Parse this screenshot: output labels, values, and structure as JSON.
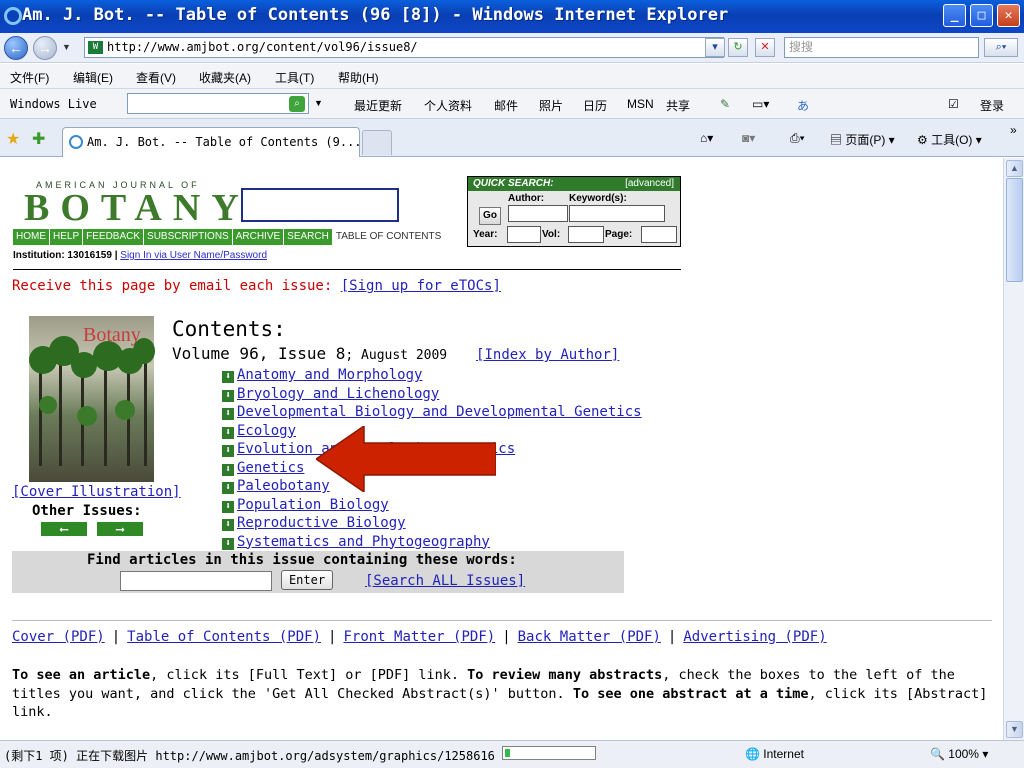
{
  "window": {
    "title": "Am. J. Bot. -- Table of Contents (96 [8]) - Windows Internet Explorer",
    "buttons": {
      "minimize": "_",
      "maximize": "□",
      "close": "✕"
    }
  },
  "address_bar": {
    "url": "http://www.amjbot.org/content/vol96/issue8/",
    "search_placeholder": "搜搜"
  },
  "menu": [
    "文件(F)",
    "编辑(E)",
    "查看(V)",
    "收藏夹(A)",
    "工具(T)",
    "帮助(H)"
  ],
  "windows_live": {
    "label": "Windows Live",
    "links": [
      "最近更新",
      "个人资料",
      "邮件",
      "照片",
      "日历",
      "MSN",
      "共享"
    ],
    "login": "登录"
  },
  "tabs": {
    "active": "Am. J. Bot. -- Table of Contents (9...",
    "tools": [
      "页面(P)",
      "工具(O)"
    ]
  },
  "header": {
    "logo_small": "AMERICAN JOURNAL OF",
    "logo_big": "BOTANY",
    "nav": [
      "HOME",
      "HELP",
      "FEEDBACK",
      "SUBSCRIPTIONS",
      "ARCHIVE",
      "SEARCH",
      "TABLE OF CONTENTS"
    ],
    "institution": "Institution: 13016159",
    "signin": "Sign In via User Name/Password"
  },
  "quick_search": {
    "title": "QUICK SEARCH:",
    "advanced": "[advanced]",
    "author_label": "Author:",
    "keywords_label": "Keyword(s):",
    "go": "Go",
    "year_label": "Year:",
    "vol_label": "Vol:",
    "page_label": "Page:"
  },
  "email": {
    "text": "Receive this page by email each issue:",
    "link": "[Sign up for eTOCs]"
  },
  "cover": {
    "title": "Botany",
    "illustration_link": "[Cover Illustration]",
    "other_issues": "Other Issues:"
  },
  "contents": {
    "heading": "Contents:",
    "volume": "Volume 96, Issue 8",
    "date": "; August 2009",
    "index_link": "[Index by Author]",
    "sections": [
      "Anatomy and Morphology",
      "Bryology and Lichenology",
      "Developmental Biology and Developmental Genetics",
      "Ecology",
      "Evolution and Population Genetics",
      "Genetics",
      "Paleobotany",
      "Population Biology",
      "Reproductive Biology",
      "Systematics and Phytogeography"
    ]
  },
  "find": {
    "prompt": "Find articles in this issue containing these words:",
    "enter": "Enter",
    "all_issues": "[Search ALL Issues]"
  },
  "pdf_links": [
    "Cover (PDF)",
    "Table of Contents (PDF)",
    "Front Matter (PDF)",
    "Back Matter (PDF)",
    "Advertising (PDF)"
  ],
  "instructions": {
    "p1_bold": "To see an article",
    "p1": ", click its [Full Text] or [PDF] link. ",
    "p2_bold": "To review many abstracts",
    "p2": ", check the boxes to the left of the titles you want, and click the 'Get All Checked Abstract(s)' button. ",
    "p3_bold": "To see one abstract at a time",
    "p3": ", click its [Abstract] link."
  },
  "status": {
    "text": "(剩下1 项) 正在下载图片 http://www.amjbot.org/adsystem/graphics/1258616",
    "progress": 0.05,
    "zone": "Internet",
    "zoom": "100%"
  },
  "colors": {
    "title_bar": "#0a4fcf",
    "journal_green": "#3a9a2c",
    "email_red": "#cc0000",
    "link_blue": "#2222bb",
    "annotation_arrow": "#cc2200"
  }
}
